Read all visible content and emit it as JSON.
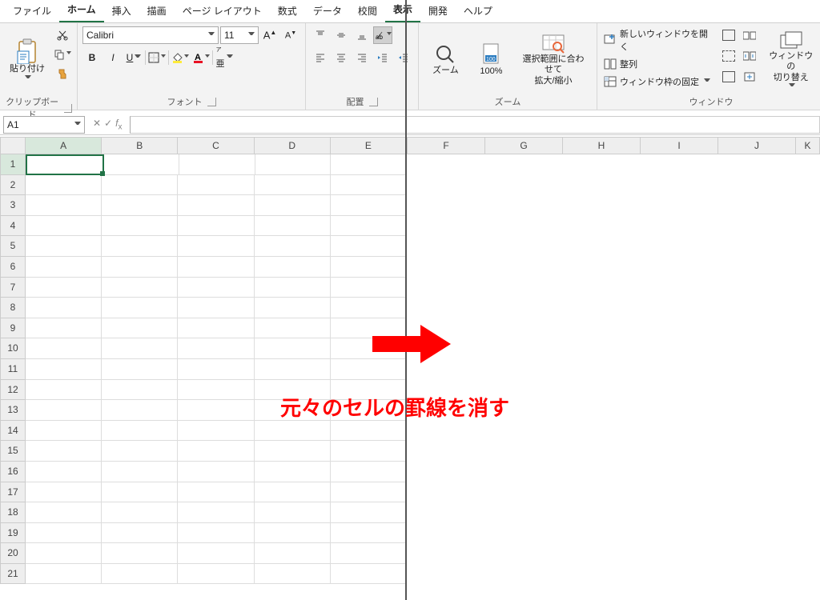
{
  "menus": {
    "file": "ファイル",
    "home": "ホーム",
    "insert": "挿入",
    "draw": "描画",
    "layout": "ページ レイアウト",
    "formulas": "数式",
    "data": "データ",
    "review": "校閲",
    "view": "表示",
    "dev": "開発",
    "help": "ヘルプ"
  },
  "ribbon": {
    "clipboard": {
      "paste": "貼り付け",
      "label": "クリップボード"
    },
    "font": {
      "name": "Calibri",
      "size": "11",
      "label": "フォント",
      "bold": "B",
      "italic": "I",
      "underline": "U"
    },
    "align": {
      "label": "配置"
    },
    "zoom": {
      "zoom": "ズーム",
      "p100": "100%",
      "fit": "選択範囲に合わせて\n拡大/縮小",
      "label": "ズーム"
    },
    "window": {
      "new": "新しいウィンドウを開く",
      "arrange": "整列",
      "freeze": "ウィンドウ枠の固定",
      "switch": "ウィンドウの\n切り替え",
      "label": "ウィンドウ"
    }
  },
  "namebox": "A1",
  "cols_left": [
    "A",
    "B",
    "C",
    "D",
    "E"
  ],
  "cols_right": [
    "F",
    "G",
    "H",
    "I",
    "J",
    "K"
  ],
  "rows": [
    "1",
    "2",
    "3",
    "4",
    "5",
    "6",
    "7",
    "8",
    "9",
    "10",
    "11",
    "12",
    "13",
    "14",
    "15",
    "16",
    "17",
    "18",
    "19",
    "20",
    "21"
  ],
  "annotation": "元々のセルの罫線を消す"
}
